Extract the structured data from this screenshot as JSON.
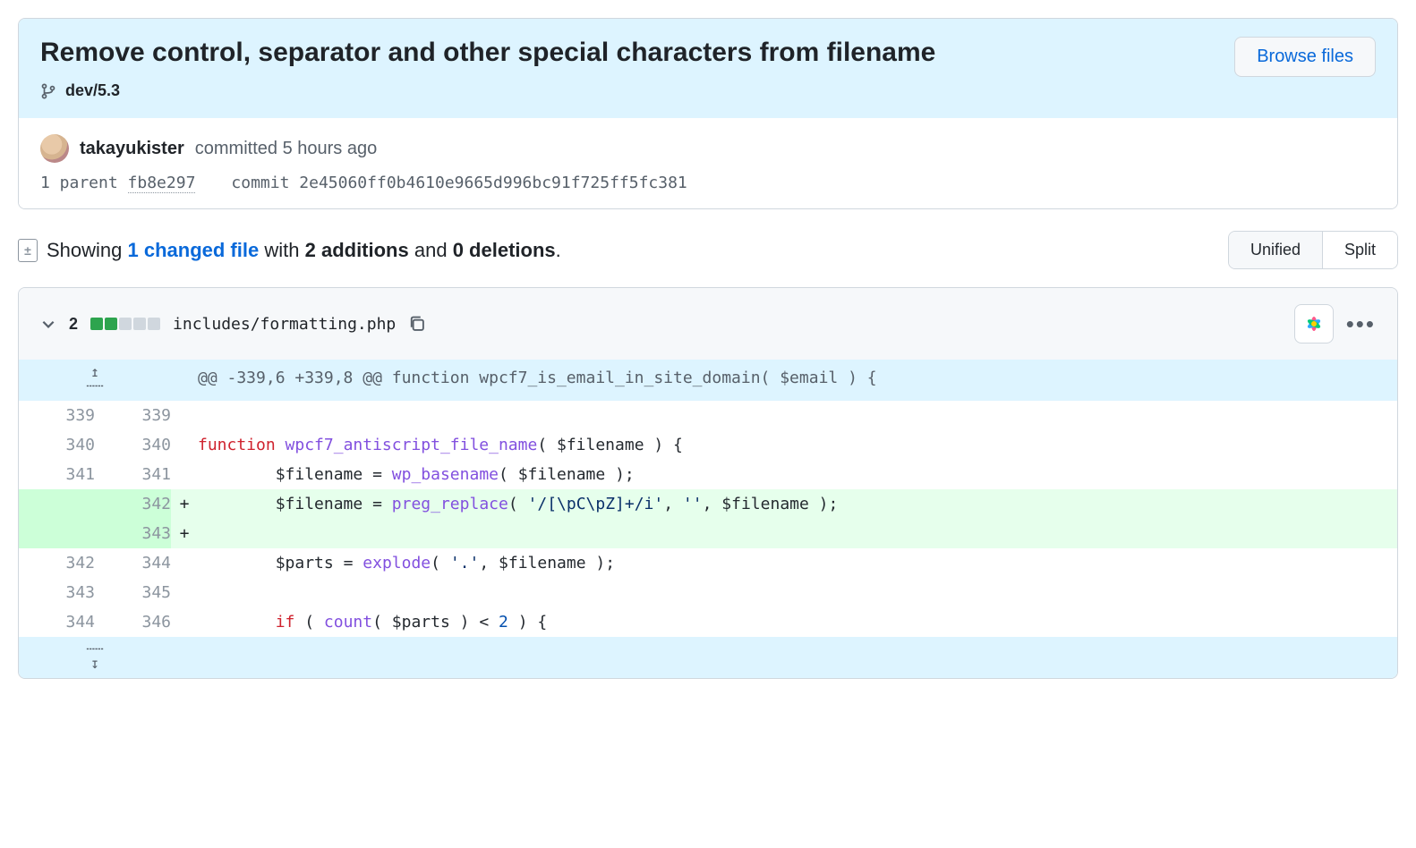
{
  "commit": {
    "title": "Remove control, separator and other special characters from filename",
    "branch": "dev/5.3",
    "browse_files": "Browse files",
    "author": "takayukister",
    "committed_label": "committed",
    "time_ago": "5 hours ago",
    "parent_count_label": "1 parent",
    "parent_sha": "fb8e297",
    "commit_label": "commit",
    "sha": "2e45060ff0b4610e9665d996bc91f725ff5fc381"
  },
  "diffstat": {
    "showing": "Showing",
    "changed_files": "1 changed file",
    "with": "with",
    "additions": "2 additions",
    "and": "and",
    "deletions": "0 deletions",
    "period": "."
  },
  "view_toggle": {
    "unified": "Unified",
    "split": "Split"
  },
  "file": {
    "change_count": "2",
    "path": "includes/formatting.php",
    "hunk_header": "@@ -339,6 +339,8 @@ function wpcf7_is_email_in_site_domain( $email ) {",
    "lines": [
      {
        "old": "339",
        "new": "339",
        "type": "ctx",
        "tokens": []
      },
      {
        "old": "340",
        "new": "340",
        "type": "ctx",
        "tokens": [
          {
            "c": "tok-kw",
            "t": "function"
          },
          {
            "t": " "
          },
          {
            "c": "tok-fn",
            "t": "wpcf7_antiscript_file_name"
          },
          {
            "t": "( "
          },
          {
            "c": "tok-var",
            "t": "$filename"
          },
          {
            "t": " ) {"
          }
        ]
      },
      {
        "old": "341",
        "new": "341",
        "type": "ctx",
        "tokens": [
          {
            "t": "        "
          },
          {
            "c": "tok-var",
            "t": "$filename"
          },
          {
            "t": " "
          },
          {
            "c": "tok-op",
            "t": "="
          },
          {
            "t": " "
          },
          {
            "c": "tok-call",
            "t": "wp_basename"
          },
          {
            "t": "( "
          },
          {
            "c": "tok-var",
            "t": "$filename"
          },
          {
            "t": " );"
          }
        ]
      },
      {
        "old": "",
        "new": "342",
        "type": "add",
        "tokens": [
          {
            "t": "        "
          },
          {
            "c": "tok-var",
            "t": "$filename"
          },
          {
            "t": " "
          },
          {
            "c": "tok-op",
            "t": "="
          },
          {
            "t": " "
          },
          {
            "c": "tok-call",
            "t": "preg_replace"
          },
          {
            "t": "( "
          },
          {
            "c": "tok-str",
            "t": "'/[\\pC\\pZ]+/i'"
          },
          {
            "t": ", "
          },
          {
            "c": "tok-str",
            "t": "''"
          },
          {
            "t": ", "
          },
          {
            "c": "tok-var",
            "t": "$filename"
          },
          {
            "t": " );"
          }
        ]
      },
      {
        "old": "",
        "new": "343",
        "type": "add",
        "tokens": []
      },
      {
        "old": "342",
        "new": "344",
        "type": "ctx",
        "tokens": [
          {
            "t": "        "
          },
          {
            "c": "tok-var",
            "t": "$parts"
          },
          {
            "t": " "
          },
          {
            "c": "tok-op",
            "t": "="
          },
          {
            "t": " "
          },
          {
            "c": "tok-call",
            "t": "explode"
          },
          {
            "t": "( "
          },
          {
            "c": "tok-str",
            "t": "'.'"
          },
          {
            "t": ", "
          },
          {
            "c": "tok-var",
            "t": "$filename"
          },
          {
            "t": " );"
          }
        ]
      },
      {
        "old": "343",
        "new": "345",
        "type": "ctx",
        "tokens": []
      },
      {
        "old": "344",
        "new": "346",
        "type": "ctx",
        "tokens": [
          {
            "t": "        "
          },
          {
            "c": "tok-kw",
            "t": "if"
          },
          {
            "t": " ( "
          },
          {
            "c": "tok-call",
            "t": "count"
          },
          {
            "t": "( "
          },
          {
            "c": "tok-var",
            "t": "$parts"
          },
          {
            "t": " ) "
          },
          {
            "c": "tok-op",
            "t": "<"
          },
          {
            "t": " "
          },
          {
            "c": "tok-num",
            "t": "2"
          },
          {
            "t": " ) {"
          }
        ]
      }
    ]
  }
}
